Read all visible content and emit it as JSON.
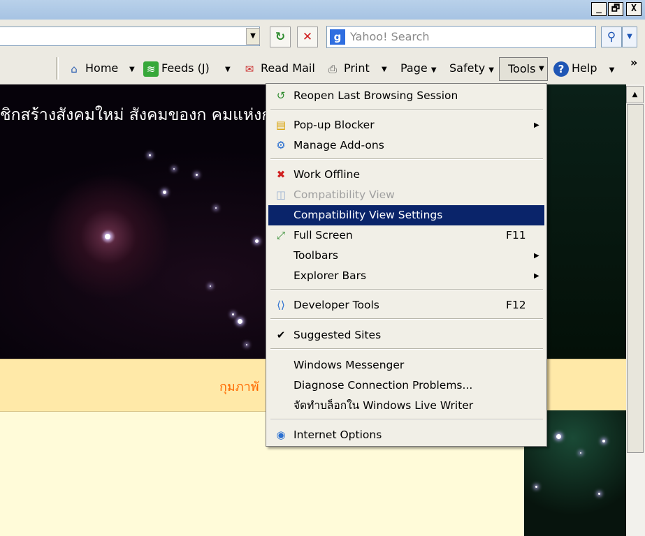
{
  "window": {
    "minimize": "_",
    "restore": "🗗",
    "close": "X"
  },
  "address": {
    "go_symbol": "↻",
    "stop_symbol": "✕"
  },
  "search": {
    "placeholder": "Yahoo! Search",
    "provider_glyph": "g",
    "go_icon": "magnifier-icon"
  },
  "commandbar": {
    "home": "Home",
    "feeds": "Feeds (J)",
    "read_mail": "Read Mail",
    "print": "Print",
    "page": "Page",
    "safety": "Safety",
    "tools": "Tools",
    "help": "Help",
    "overflow": "»"
  },
  "content": {
    "banner_text": "ชิกสร้างสังคมใหม่ สังคมของก                                                         คมแห่งก",
    "strip_text": "กุมภาพั"
  },
  "tools_menu": {
    "items": [
      {
        "label": "Reopen Last Browsing Session",
        "icon": "reopen-session-icon"
      },
      {
        "label": "Pop-up Blocker",
        "icon": "popup-blocker-icon",
        "submenu": true
      },
      {
        "label": "Manage Add-ons",
        "icon": "addons-icon"
      },
      {
        "label": "Work Offline",
        "icon": "work-offline-icon"
      },
      {
        "label": "Compatibility View",
        "icon": "compatibility-icon",
        "disabled": true
      },
      {
        "label": "Compatibility View Settings",
        "highlighted": true
      },
      {
        "label": "Full Screen",
        "icon": "fullscreen-icon",
        "shortcut": "F11"
      },
      {
        "label": "Toolbars",
        "submenu": true
      },
      {
        "label": "Explorer Bars",
        "submenu": true
      },
      {
        "label": "Developer Tools",
        "icon": "developer-tools-icon",
        "shortcut": "F12"
      },
      {
        "label": "Suggested Sites",
        "checked": true
      },
      {
        "label": "Windows Messenger"
      },
      {
        "label": "Diagnose Connection Problems..."
      },
      {
        "label": "จัดทำบล็อกใน Windows Live Writer"
      },
      {
        "label": "Internet Options",
        "icon": "internet-options-icon"
      }
    ],
    "submenu_arrow": "▶",
    "checkmark": "✔"
  },
  "colors": {
    "highlight": "#0a246a",
    "menu_bg": "#f1efe7",
    "strip_text": "#ff6a00"
  }
}
